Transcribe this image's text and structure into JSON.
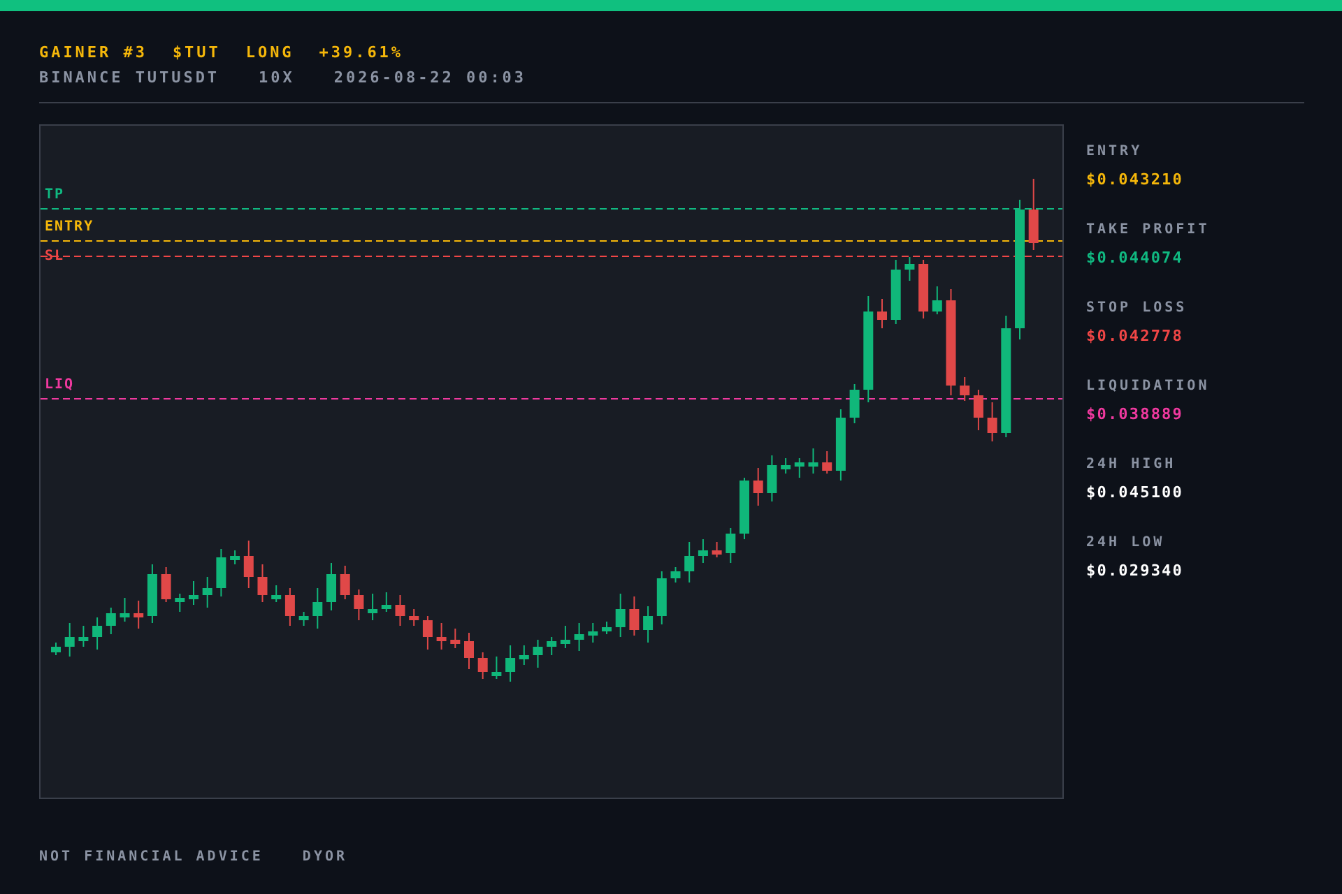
{
  "header": {
    "title_parts": [
      {
        "text": "GAINER #3",
        "color": "#f5b70a"
      },
      {
        "text": "$TUT",
        "color": "#f5b70a"
      },
      {
        "text": "LONG",
        "color": "#f5b70a"
      },
      {
        "text": "+39.61%",
        "color": "#f5b70a"
      }
    ],
    "subtitle_parts": [
      "BINANCE TUTUSDT",
      "10X",
      "2026-08-22 00:03"
    ]
  },
  "chart": {
    "levels": [
      {
        "kind": "tp",
        "label": "TP",
        "color": "#10b981"
      },
      {
        "kind": "entry",
        "label": "ENTRY",
        "color": "#f5b70a"
      },
      {
        "kind": "sl",
        "label": "SL",
        "color": "#f04646"
      },
      {
        "kind": "liq",
        "label": "LIQ",
        "color": "#f0399f"
      }
    ]
  },
  "stats": [
    {
      "label": "ENTRY",
      "value": "$0.043210",
      "color": "#f5b70a"
    },
    {
      "label": "TAKE PROFIT",
      "value": "$0.044074",
      "color": "#10b981"
    },
    {
      "label": "STOP LOSS",
      "value": "$0.042778",
      "color": "#f04646"
    },
    {
      "label": "LIQUIDATION",
      "value": "$0.038889",
      "color": "#f0399f"
    },
    {
      "label": "24H HIGH",
      "value": "$0.045100",
      "color": "#ffffff"
    },
    {
      "label": "24H LOW",
      "value": "$0.029340",
      "color": "#ffffff"
    }
  ],
  "footer": [
    "NOT FINANCIAL ADVICE",
    "DYOR"
  ]
}
